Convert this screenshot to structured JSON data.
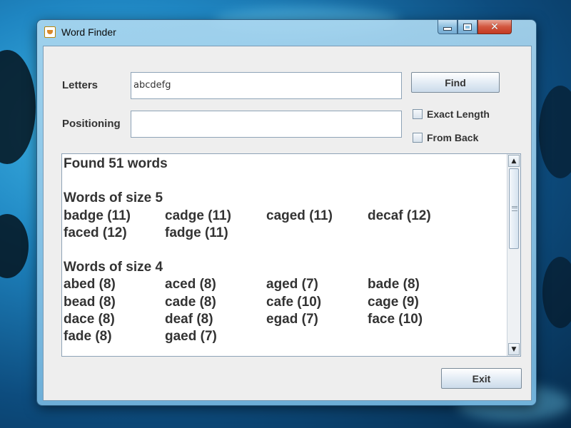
{
  "window": {
    "title": "Word Finder",
    "icons": {
      "app": "java-cup-icon",
      "minimize": "minimize-icon",
      "maximize": "maximize-icon",
      "close": "close-icon"
    },
    "close_glyph": "✕"
  },
  "form": {
    "letters_label": "Letters",
    "letters_value": "abcdefg",
    "positioning_label": "Positioning",
    "positioning_value": "",
    "find_label": "Find",
    "exact_length_label": "Exact Length",
    "exact_length_checked": false,
    "from_back_label": "From Back",
    "from_back_checked": false
  },
  "results": {
    "summary": "Found 51 words",
    "groups": [
      {
        "heading": "Words of size 5",
        "words": [
          "badge (11)",
          "cadge (11)",
          "caged (11)",
          "decaf (12)",
          "faced (12)",
          "fadge (11)"
        ]
      },
      {
        "heading": "Words of size 4",
        "words": [
          "abed (8)",
          "aced (8)",
          "aged (7)",
          "bade (8)",
          "bead (8)",
          "cade (8)",
          "cafe (10)",
          "cage (9)",
          "dace (8)",
          "deaf (8)",
          "egad (7)",
          "face (10)",
          "fade (8)",
          "gaed (7)"
        ]
      }
    ],
    "scroll_fraction": 0.0
  },
  "footer": {
    "exit_label": "Exit"
  },
  "colors": {
    "accent": "#1f86c2",
    "text": "#333333"
  }
}
